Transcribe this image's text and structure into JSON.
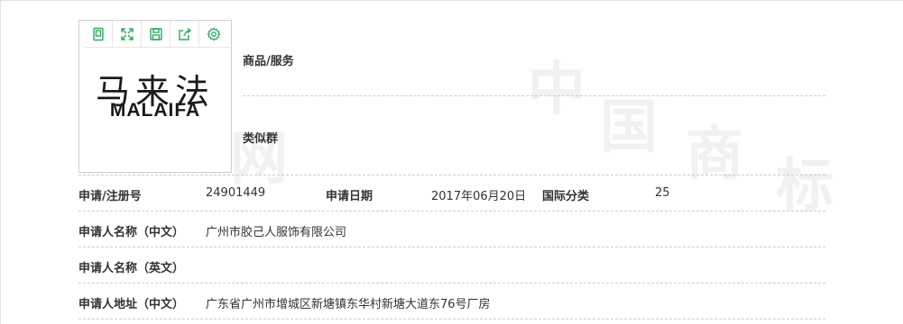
{
  "watermark": {
    "chars": [
      "中",
      "国",
      "商",
      "标",
      "网"
    ]
  },
  "logo": {
    "chinese": "马来法",
    "english": "MALAIFA"
  },
  "toolbar": {
    "icons": [
      "document-icon",
      "expand-icon",
      "save-icon",
      "share-icon",
      "settings-icon"
    ],
    "accent_color": "#2eaa5f"
  },
  "goods": {
    "label": "商品/服务",
    "value": ""
  },
  "similar_group": {
    "label": "类似群",
    "value": ""
  },
  "reg_no": {
    "label": "申请/注册号",
    "value": "24901449"
  },
  "app_date": {
    "label": "申请日期",
    "value": "2017年06月20日"
  },
  "intl_class": {
    "label": "国际分类",
    "value": "25"
  },
  "name_cn": {
    "label": "申请人名称（中文）",
    "value": "广州市胶己人服饰有限公司"
  },
  "name_en": {
    "label": "申请人名称（英文）",
    "value": ""
  },
  "address_cn": {
    "label": "申请人地址（中文）",
    "value": "广东省广州市增城区新塘镇东华村新塘大道东76号厂房"
  }
}
